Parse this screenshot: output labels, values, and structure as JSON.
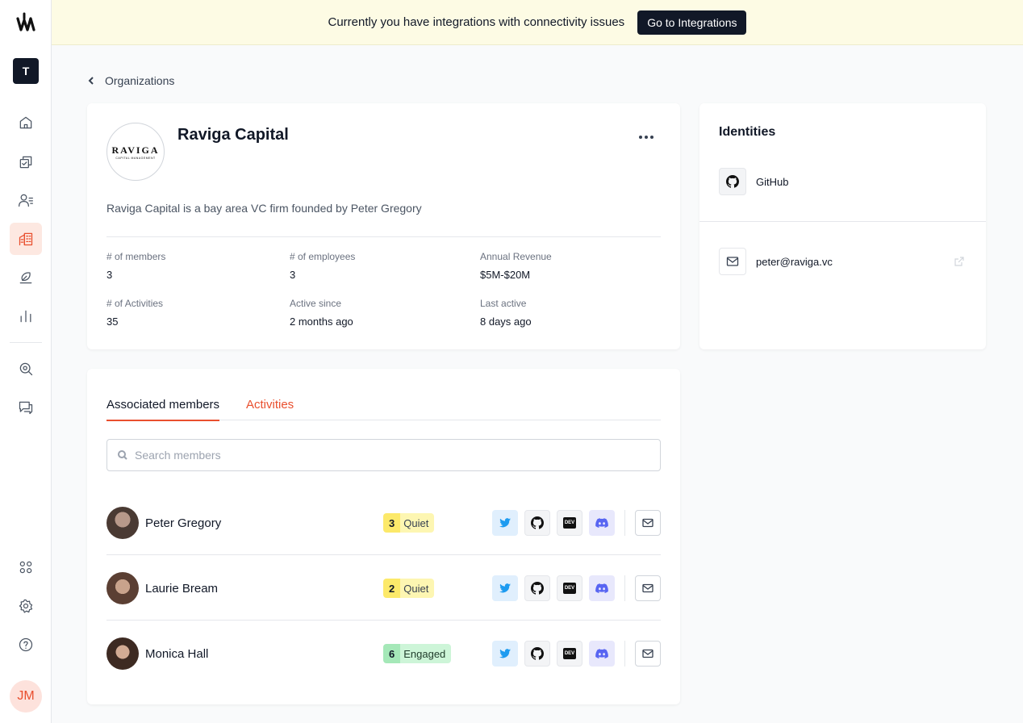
{
  "sidebar": {
    "workspace_initial": "T",
    "user_initials": "JM"
  },
  "banner": {
    "message": "Currently you have integrations with connectivity issues",
    "button_label": "Go to Integrations"
  },
  "breadcrumb": {
    "label": "Organizations"
  },
  "organization": {
    "logo_text": "RAVIGA",
    "logo_subtext": "CAPITAL MANAGEMENT",
    "name": "Raviga Capital",
    "description": "Raviga Capital is a bay area VC firm founded by Peter Gregory",
    "stats": [
      {
        "label": "# of members",
        "value": "3"
      },
      {
        "label": "# of employees",
        "value": "3"
      },
      {
        "label": "Annual Revenue",
        "value": "$5M-$20M"
      },
      {
        "label": "# of Activities",
        "value": "35"
      },
      {
        "label": "Active since",
        "value": "2 months ago"
      },
      {
        "label": "Last active",
        "value": "8 days ago"
      }
    ]
  },
  "identities": {
    "title": "Identities",
    "items": [
      {
        "label": "GitHub",
        "icon": "github-icon"
      },
      {
        "label": "peter@raviga.vc",
        "icon": "mail-icon"
      }
    ]
  },
  "members_section": {
    "tabs": [
      {
        "label": "Associated members",
        "active": true
      },
      {
        "label": "Activities",
        "active": false
      }
    ],
    "search_placeholder": "Search members",
    "members": [
      {
        "name": "Peter Gregory",
        "score": "3",
        "status": "Quiet"
      },
      {
        "name": "Laurie Bream",
        "score": "2",
        "status": "Quiet"
      },
      {
        "name": "Monica Hall",
        "score": "6",
        "status": "Engaged"
      }
    ]
  },
  "colors": {
    "accent": "#e94f2e",
    "banner_bg": "#fdfbe4",
    "quiet": "#fce96a",
    "engaged": "#a5e8b8"
  }
}
